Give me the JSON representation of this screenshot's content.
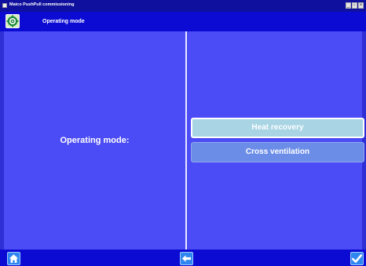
{
  "window": {
    "title": "Maico PushPull commissioning",
    "controls": {
      "minimize": "_",
      "maximize": "▫",
      "close": "×"
    }
  },
  "header": {
    "icon": "gear-icon",
    "title": "Operating mode"
  },
  "main": {
    "label": "Operating mode:",
    "options": [
      {
        "label": "Heat recovery",
        "selected": true
      },
      {
        "label": "Cross ventilation",
        "selected": false
      }
    ]
  },
  "footer": {
    "icons": [
      "home-icon",
      "back-arrow-icon",
      "checkmark-icon"
    ]
  },
  "colors": {
    "background": "#2f2fd6",
    "panel": "#4c4cf6",
    "bar": "#0b0bd4",
    "selected_option": "#a8d4e4",
    "option": "#6b8de8",
    "nav_button": "#2f86f0"
  }
}
